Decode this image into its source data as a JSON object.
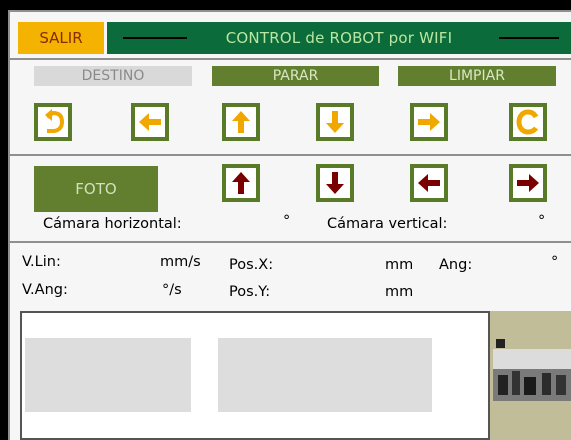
{
  "header": {
    "exit_label": "SALIR",
    "title": "CONTROL de ROBOT por WIFI"
  },
  "buttons": {
    "destination": "DESTINO",
    "stop": "PARAR",
    "clear": "LIMPIAR",
    "photo": "FOTO"
  },
  "camera": {
    "horizontal_label": "Cámara horizontal:",
    "horizontal_unit": "°",
    "vertical_label": "Cámara vertical:",
    "vertical_unit": "°"
  },
  "telemetry": {
    "vlin_label": "V.Lin:",
    "vlin_unit": "mm/s",
    "vang_label": "V.Ang:",
    "vang_unit": "°/s",
    "posx_label": "Pos.X:",
    "posx_unit": "mm",
    "posy_label": "Pos.Y:",
    "posy_unit": "mm",
    "ang_label": "Ang:",
    "ang_unit": "°"
  },
  "colors": {
    "accent_green": "#597a27",
    "title_green": "#0b6b3a",
    "exit_yellow": "#f3b300",
    "arrow_orange": "#f0a800",
    "arrow_red": "#7a0000"
  }
}
